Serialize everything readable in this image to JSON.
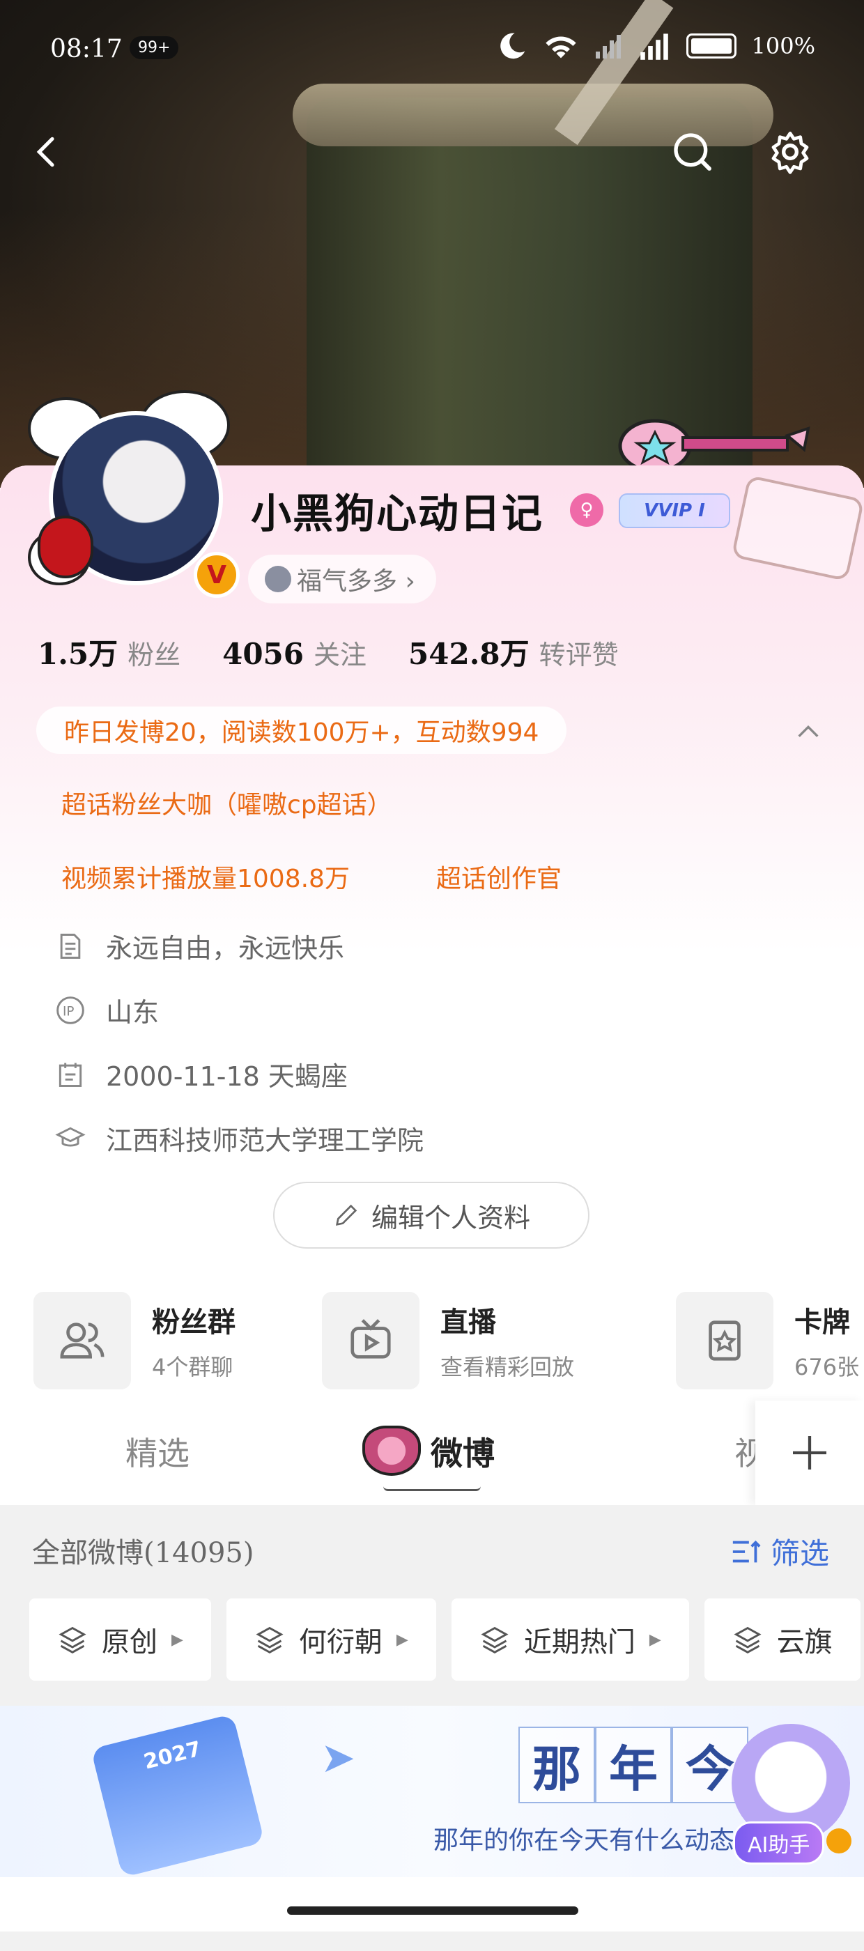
{
  "status_bar": {
    "time": "08:17",
    "notif_badge": "99+",
    "signal": "5G",
    "battery": "100%"
  },
  "profile": {
    "nickname": "小黑狗心动日记",
    "vip_label": "VVIP I",
    "fuqi_label": "福气多多 ›",
    "stats": [
      {
        "num": "1.5",
        "unit": "万",
        "label": "粉丝"
      },
      {
        "num": "4056",
        "unit": "",
        "label": "关注"
      },
      {
        "num": "542.8",
        "unit": "万",
        "label": "转评赞"
      }
    ],
    "activity": "昨日发博20，阅读数100万+，互动数994",
    "badges": [
      "超话粉丝大咖（嚯嗷cp超话）",
      "视频累计播放量1008.8万",
      "超话创作官"
    ],
    "bio": "永远自由，永远快乐",
    "ip": "山东",
    "birthday": "2000-11-18 天蝎座",
    "school": "江西科技师范大学理工学院",
    "edit_label": "编辑个人资料"
  },
  "quick_links": [
    {
      "title": "粉丝群",
      "sub": "4个群聊",
      "icon": "people-icon"
    },
    {
      "title": "直播",
      "sub": "查看精彩回放",
      "icon": "tv-icon"
    },
    {
      "title": "卡牌",
      "sub": "676张",
      "icon": "card-icon"
    }
  ],
  "tabs": {
    "items": [
      "精选",
      "微博",
      "视"
    ],
    "active": "微博"
  },
  "feed": {
    "all_label": "全部微博",
    "count": "(14095)",
    "filter_label": "筛选",
    "chips": [
      "原创",
      "何衍朝",
      "近期热门",
      "云旗"
    ]
  },
  "banner": {
    "year": "2027",
    "title_chars": [
      "那",
      "年",
      "今"
    ],
    "subtitle": "那年的你在今天有什么动态",
    "ai_label": "AI助手"
  }
}
